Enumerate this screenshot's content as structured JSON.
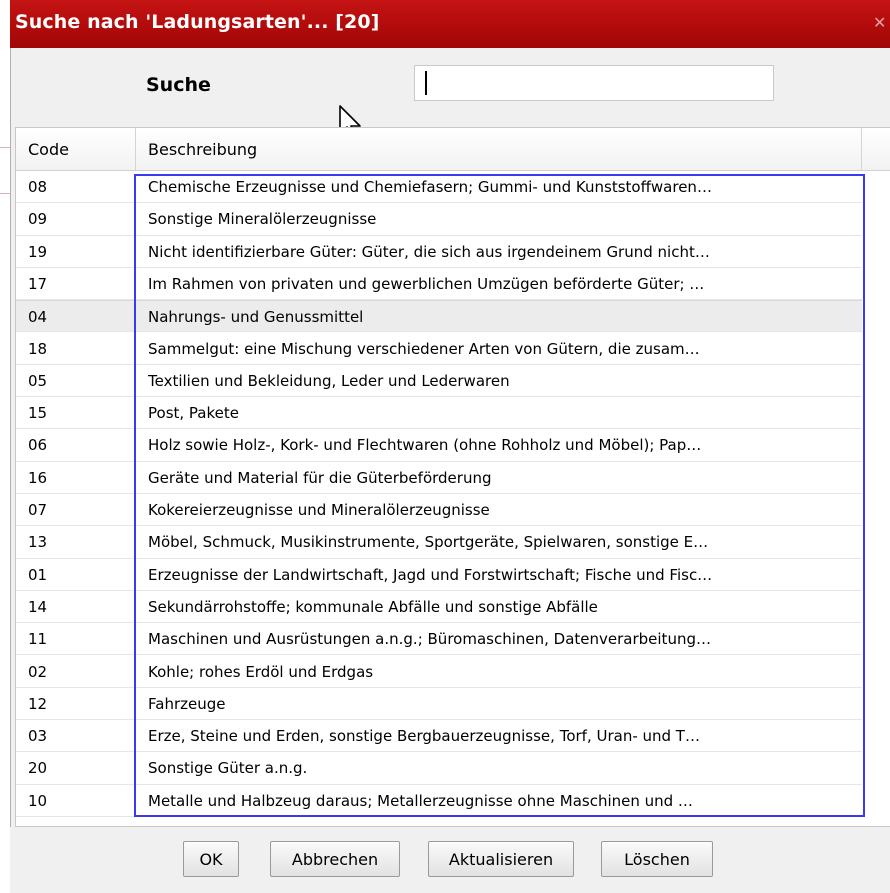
{
  "dialog": {
    "title": "Suche nach 'Ladungsarten'... [20]",
    "close_icon": "close-icon"
  },
  "search": {
    "label": "Suche",
    "value": ""
  },
  "table": {
    "columns": [
      "Code",
      "Beschreibung"
    ],
    "selected_index": 4,
    "rows": [
      {
        "code": "08",
        "desc": "Chemische Erzeugnisse und Chemiefasern; Gummi- und Kunststoffwaren…"
      },
      {
        "code": "09",
        "desc": "Sonstige Mineralölerzeugnisse"
      },
      {
        "code": "19",
        "desc": "Nicht identifizierbare Güter: Güter, die sich aus irgendeinem Grund nicht…"
      },
      {
        "code": "17",
        "desc": "Im Rahmen von privaten und gewerblichen Umzügen beförderte Güter; …"
      },
      {
        "code": "04",
        "desc": "Nahrungs- und Genussmittel"
      },
      {
        "code": "18",
        "desc": "Sammelgut: eine Mischung verschiedener Arten von Gütern, die zusam…"
      },
      {
        "code": "05",
        "desc": "Textilien und Bekleidung, Leder und Lederwaren"
      },
      {
        "code": "15",
        "desc": "Post, Pakete"
      },
      {
        "code": "06",
        "desc": "Holz sowie Holz-, Kork- und Flechtwaren (ohne Rohholz und Möbel); Pap…"
      },
      {
        "code": "16",
        "desc": "Geräte und Material für die Güterbeförderung"
      },
      {
        "code": "07",
        "desc": "Kokereierzeugnisse und Mineralölerzeugnisse"
      },
      {
        "code": "13",
        "desc": "Möbel, Schmuck, Musikinstrumente, Sportgeräte, Spielwaren, sonstige E…"
      },
      {
        "code": "01",
        "desc": "Erzeugnisse der Landwirtschaft, Jagd und Forstwirtschaft; Fische und Fisc…"
      },
      {
        "code": "14",
        "desc": "Sekundärrohstoffe; kommunale Abfälle und sonstige Abfälle"
      },
      {
        "code": "11",
        "desc": "Maschinen und Ausrüstungen a.n.g.; Büromaschinen, Datenverarbeitung…"
      },
      {
        "code": "02",
        "desc": "Kohle; rohes Erdöl und Erdgas"
      },
      {
        "code": "12",
        "desc": "Fahrzeuge"
      },
      {
        "code": "03",
        "desc": "Erze, Steine und Erden, sonstige Bergbauerzeugnisse, Torf, Uran- und T…"
      },
      {
        "code": "20",
        "desc": "Sonstige Güter a.n.g."
      },
      {
        "code": "10",
        "desc": "Metalle und Halbzeug daraus; Metallerzeugnisse ohne Maschinen und …"
      }
    ]
  },
  "buttons": {
    "ok": "OK",
    "cancel": "Abbrechen",
    "refresh": "Aktualisieren",
    "clear": "Löschen"
  },
  "colors": {
    "titlebar": "#b20b0b",
    "highlight_border": "#3a3af0",
    "selected_row": "#ececec"
  }
}
